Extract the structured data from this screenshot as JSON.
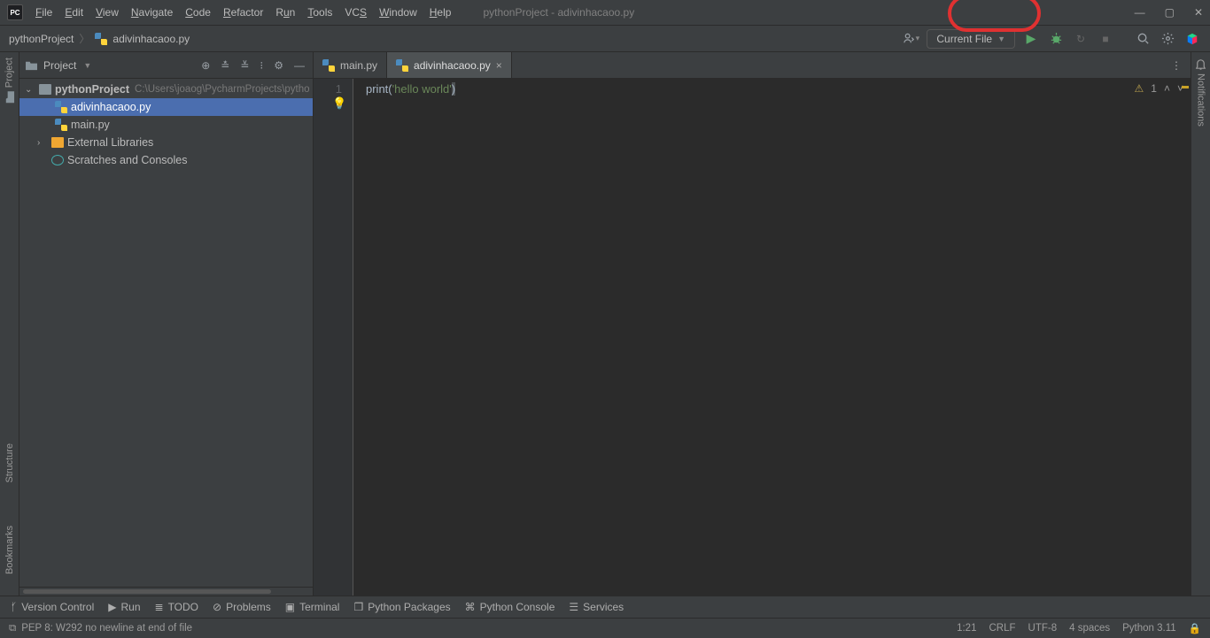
{
  "title_app": "pythonProject - adivinhacaoo.py",
  "logo_text": "PC",
  "menu": [
    "File",
    "Edit",
    "View",
    "Navigate",
    "Code",
    "Refactor",
    "Run",
    "Tools",
    "VCS",
    "Window",
    "Help"
  ],
  "breadcrumb": {
    "project": "pythonProject",
    "file": "adivinhacaoo.py"
  },
  "runconfig": "Current File",
  "leftrail": {
    "project": "Project",
    "structure": "Structure",
    "bookmarks": "Bookmarks"
  },
  "rightrail": {
    "notifications": "Notifications"
  },
  "project_panel": {
    "title": "Project",
    "root": "pythonProject",
    "root_path": "C:\\Users\\joaog\\PycharmProjects\\pytho",
    "files": [
      "adivinhacaoo.py",
      "main.py"
    ],
    "external": "External Libraries",
    "scratch": "Scratches and Consoles"
  },
  "tabs": [
    {
      "name": "main.py",
      "active": false
    },
    {
      "name": "adivinhacaoo.py",
      "active": true
    }
  ],
  "code_line_number": "1",
  "code_tokens": {
    "fn": "print",
    "p1": "(",
    "s": "'hello world'",
    "p2": ")"
  },
  "inspection": {
    "warn_icon": "⚠",
    "count": "1"
  },
  "toolwindows": [
    "Version Control",
    "Run",
    "TODO",
    "Problems",
    "Terminal",
    "Python Packages",
    "Python Console",
    "Services"
  ],
  "status": {
    "msg": "PEP 8: W292 no newline at end of file",
    "pos": "1:21",
    "lineend": "CRLF",
    "enc": "UTF-8",
    "indent": "4 spaces",
    "interp": "Python 3.11"
  }
}
